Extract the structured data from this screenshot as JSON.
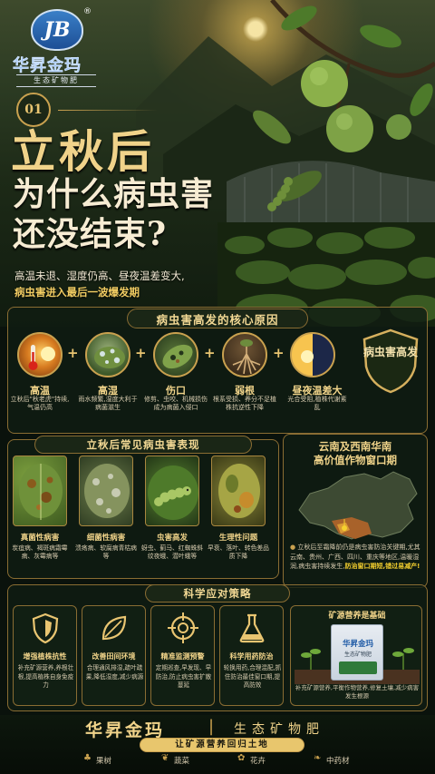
{
  "brand": {
    "logo_letters": "JB",
    "name": "华昇金玛",
    "tagline": "生态矿物肥",
    "registered": "®"
  },
  "hero": {
    "number": "01",
    "title_line1": "立秋后",
    "title_line2": "为什么病虫害",
    "title_line3": "还没结束?",
    "subtitle_line1": "高温未退、湿度仍高、昼夜温差变大,",
    "subtitle_line2": "病虫害进入最后一波爆发期"
  },
  "causes": {
    "section_title": "病虫害高发的核心原因",
    "items": [
      {
        "title": "高温",
        "desc": "立秋后\"秋老虎\"持续,气温仍高",
        "icon": "sun-thermometer-icon"
      },
      {
        "title": "高湿",
        "desc": "雨水频繁,湿度大利于病菌滋生",
        "icon": "water-droplet-icon"
      },
      {
        "title": "伤口",
        "desc": "修剪、虫咬、机械损伤成为病菌入侵口",
        "icon": "damaged-leaf-icon"
      },
      {
        "title": "弱根",
        "desc": "根系受损、养分不足植株抗逆性下降",
        "icon": "roots-icon"
      },
      {
        "title": "昼夜温差大",
        "desc": "光合受阻,植株代谢紊乱",
        "icon": "sun-moon-icon"
      }
    ],
    "result_label": "病虫害高发",
    "plus": "+",
    "equals": "="
  },
  "pests": {
    "section_title": "立秋后常见病虫害表现",
    "items": [
      {
        "title": "真菌性病害",
        "desc": "炭疽病、褐斑病霜霉病、灰霉病等"
      },
      {
        "title": "细菌性病害",
        "desc": "溃疡病、软腐病青枯病等"
      },
      {
        "title": "虫害高发",
        "desc": "蚜虫、蓟马、红蜘蛛斜纹夜蛾、潜叶蛾等"
      },
      {
        "title": "生理性问题",
        "desc": "早衰、落叶、转色差品质下降"
      }
    ]
  },
  "region": {
    "title_line1": "云南及西南华南",
    "title_line2": "高价值作物窗口期",
    "desc": "立秋后至霜降前仍是病虫害防治关键期,尤其云南、贵州、广西、四川、重庆等地区,温暖湿润,病虫害持续发生,",
    "highlight": "防治窗口期短,错过易减产!",
    "map_label": "china-map"
  },
  "strategies": {
    "section_title": "科学应对策略",
    "items": [
      {
        "title": "增强植株抗性",
        "desc": "补充矿源营养,养根壮根,提高植株自身免疫力",
        "icon": "shield-icon"
      },
      {
        "title": "改善田间环境",
        "desc": "合理通风排湿,疏叶疏果,降低湿度,减少病源",
        "icon": "leaf-icon"
      },
      {
        "title": "精准监测预警",
        "desc": "定期巡查,早发现、早防治,防止病虫害扩散蔓延",
        "icon": "target-icon"
      },
      {
        "title": "科学用药防治",
        "desc": "轮换用药,合理混配,抓住防治最佳窗口期,提高防效",
        "icon": "flask-icon"
      }
    ],
    "base_title": "矿源营养是基础",
    "base_desc": "补充矿源营养,平衡作物营养,修复土壤,减少病害发生根源",
    "bag_brand": "华昇金玛",
    "bag_sub": "生态矿物肥"
  },
  "footer": {
    "brand": "华昇金玛",
    "divider": "|",
    "product": "生态矿物肥",
    "slogan": "让矿源营养回归土地",
    "crops": [
      {
        "label": "果树",
        "icon": "fruit-tree-icon"
      },
      {
        "label": "蔬菜",
        "icon": "vegetable-icon"
      },
      {
        "label": "花卉",
        "icon": "flower-icon"
      },
      {
        "label": "中药材",
        "icon": "herb-icon"
      }
    ]
  },
  "colors": {
    "gold": "#e9c571",
    "dark_green": "#0f1a10",
    "highlight_yellow": "#f5d02e",
    "accent_red": "#c02a1e"
  }
}
